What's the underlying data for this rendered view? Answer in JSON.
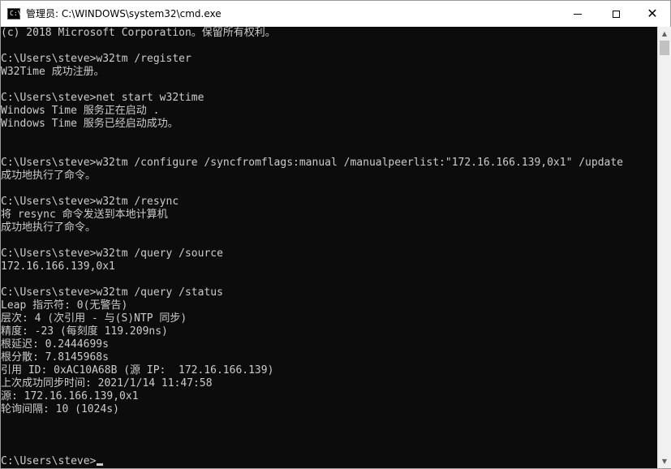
{
  "window": {
    "title": "管理员: C:\\WINDOWS\\system32\\cmd.exe",
    "icon": "cmd-icon",
    "icon_glyph": "C:\\",
    "controls": {
      "minimize": "minimize-icon",
      "maximize": "maximize-icon",
      "close_glyph": "✕"
    }
  },
  "console": {
    "lines": [
      "(c) 2018 Microsoft Corporation。保留所有权利。",
      "",
      "C:\\Users\\steve>w32tm /register",
      "W32Time 成功注册。",
      "",
      "C:\\Users\\steve>net start w32time",
      "Windows Time 服务正在启动 .",
      "Windows Time 服务已经启动成功。",
      "",
      "",
      "C:\\Users\\steve>w32tm /configure /syncfromflags:manual /manualpeerlist:\"172.16.166.139,0x1\" /update",
      "成功地执行了命令。",
      "",
      "C:\\Users\\steve>w32tm /resync",
      "将 resync 命令发送到本地计算机",
      "成功地执行了命令。",
      "",
      "C:\\Users\\steve>w32tm /query /source",
      "172.16.166.139,0x1",
      "",
      "C:\\Users\\steve>w32tm /query /status",
      "Leap 指示符: 0(无警告)",
      "层次: 4 (次引用 - 与(S)NTP 同步)",
      "精度: -23 (每刻度 119.209ns)",
      "根延迟: 0.2444699s",
      "根分散: 7.8145968s",
      "引用 ID: 0xAC10A68B (源 IP:  172.16.166.139)",
      "上次成功同步时间: 2021/1/14 11:47:58",
      "源: 172.16.166.139,0x1",
      "轮询间隔: 10 (1024s)",
      "",
      "",
      ""
    ],
    "prompt": "C:\\Users\\steve>"
  },
  "scrollbar": {
    "up_glyph": "▲",
    "down_glyph": "▼"
  },
  "colors": {
    "console_bg": "#0c0c0c",
    "console_text": "#cccccc",
    "titlebar_bg": "#ffffff"
  }
}
